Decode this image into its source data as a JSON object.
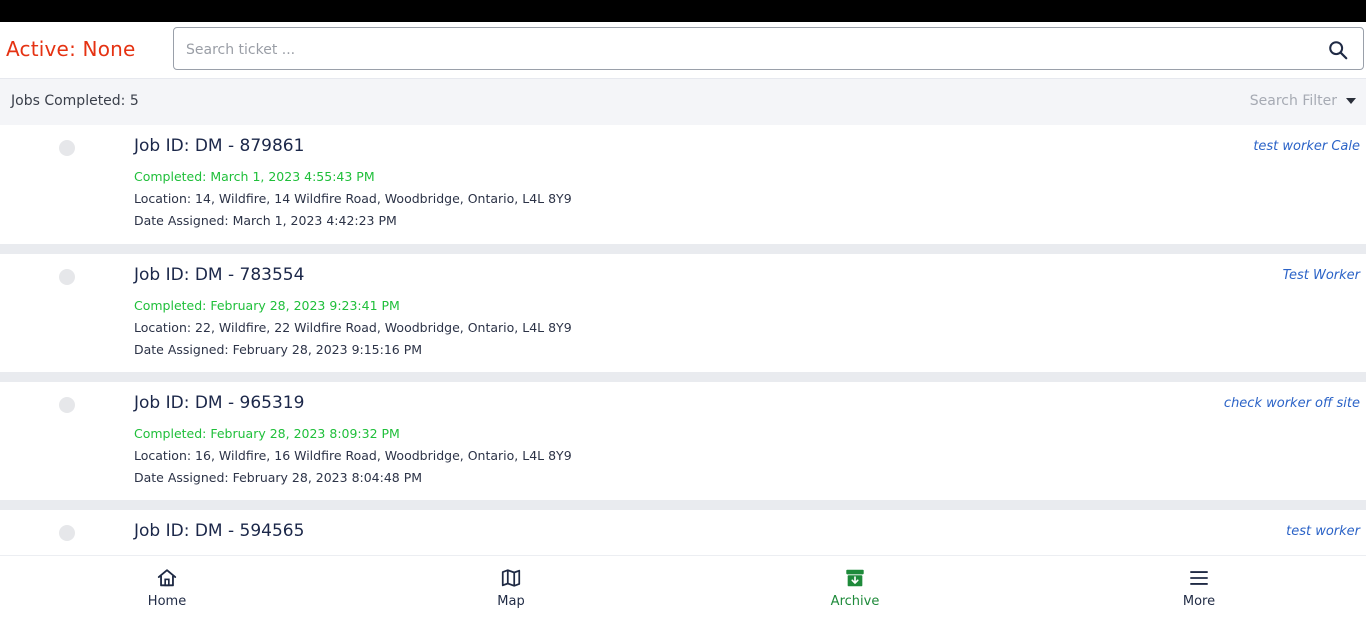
{
  "header": {
    "active_label": "Active: None",
    "search_placeholder": "Search ticket ...",
    "search_value": ""
  },
  "filterbar": {
    "jobs_completed": "Jobs Completed: 5",
    "search_filter": "Search Filter"
  },
  "jobs": [
    {
      "job_id": "Job ID: DM - 879861",
      "worker": "test worker Cale",
      "completed": "Completed: March 1, 2023 4:55:43 PM",
      "location": "Location: 14, Wildfire, 14 Wildfire Road, Woodbridge, Ontario, L4L 8Y9",
      "date_assigned": "Date Assigned: March 1, 2023 4:42:23 PM"
    },
    {
      "job_id": "Job ID: DM - 783554",
      "worker": "Test Worker",
      "completed": "Completed: February 28, 2023 9:23:41 PM",
      "location": "Location: 22, Wildfire, 22 Wildfire Road, Woodbridge, Ontario, L4L 8Y9",
      "date_assigned": "Date Assigned: February 28, 2023 9:15:16 PM"
    },
    {
      "job_id": "Job ID: DM - 965319",
      "worker": "check worker off site",
      "completed": "Completed: February 28, 2023 8:09:32 PM",
      "location": "Location: 16, Wildfire, 16 Wildfire Road, Woodbridge, Ontario, L4L 8Y9",
      "date_assigned": "Date Assigned: February 28, 2023 8:04:48 PM"
    },
    {
      "job_id": "Job ID: DM - 594565",
      "worker": "test worker"
    }
  ],
  "nav": {
    "items": [
      {
        "label": "Home",
        "icon": "home-icon"
      },
      {
        "label": "Map",
        "icon": "map-icon"
      },
      {
        "label": "Archive",
        "icon": "archive-icon",
        "active": true
      },
      {
        "label": "More",
        "icon": "menu-icon"
      }
    ]
  },
  "colors": {
    "active_label": "#e53212",
    "completed": "#1fbf3a",
    "worker_link": "#2b63c7",
    "nav_active": "#1e8a3a"
  }
}
